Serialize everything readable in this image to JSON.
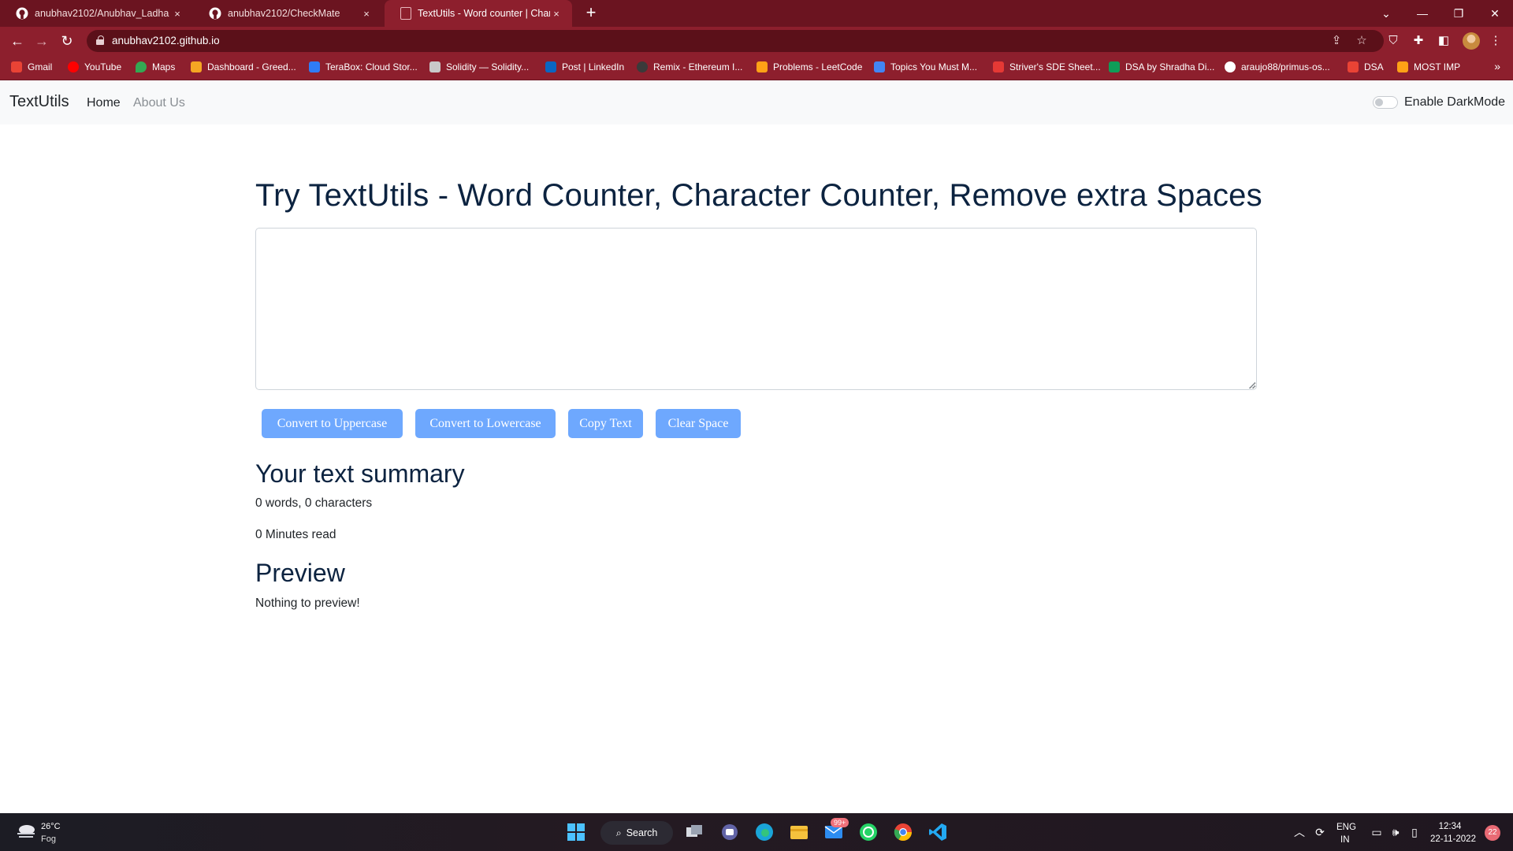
{
  "browser": {
    "tabs": [
      {
        "title": "anubhav2102/Anubhav_Ladha",
        "close": "×"
      },
      {
        "title": "anubhav2102/CheckMate",
        "close": "×"
      },
      {
        "title": "TextUtils - Word counter | Charac",
        "close": "×"
      }
    ],
    "new_tab": "+",
    "url": "anubhav2102.github.io",
    "bookmarks": [
      {
        "label": "Gmail",
        "color": "#ea4335"
      },
      {
        "label": "YouTube",
        "color": "#ff0000"
      },
      {
        "label": "Maps",
        "color": "#34a853"
      },
      {
        "label": "Dashboard - Greed...",
        "color": "#f5a623"
      },
      {
        "label": "TeraBox: Cloud Stor...",
        "color": "#2f7cf6"
      },
      {
        "label": "Solidity — Solidity...",
        "color": "#c9c9c9"
      },
      {
        "label": "Post | LinkedIn",
        "color": "#0a66c2"
      },
      {
        "label": "Remix - Ethereum I...",
        "color": "#3a3a3a"
      },
      {
        "label": "Problems - LeetCode",
        "color": "#ffa116"
      },
      {
        "label": "Topics You Must M...",
        "color": "#4285f4"
      },
      {
        "label": "Striver's SDE Sheet...",
        "color": "#e53935"
      },
      {
        "label": "DSA by Shradha Di...",
        "color": "#0f9d58"
      },
      {
        "label": "araujo88/primus-os...",
        "color": "#ffffff"
      },
      {
        "label": "DSA",
        "color": "#ea4335"
      },
      {
        "label": "MOST IMP",
        "color": "#ffa116"
      }
    ]
  },
  "site": {
    "brand": "TextUtils",
    "nav": {
      "home": "Home",
      "about": "About Us"
    },
    "darkmode_label": "Enable DarkMode",
    "darkmode_on": false,
    "heading": "Try TextUtils - Word Counter, Character Counter, Remove extra Spaces",
    "textarea_value": "",
    "buttons": {
      "uppercase": "Convert to Uppercase",
      "lowercase": "Convert to Lowercase",
      "copy": "Copy Text",
      "clear": "Clear Space"
    },
    "summary_heading": "Your text summary",
    "summary_counts": "0 words, 0 characters",
    "read_time": "0 Minutes read",
    "preview_heading": "Preview",
    "preview_text": "Nothing to preview!",
    "colors": {
      "accent": "#6ea8fe",
      "heading": "#0c2340",
      "tab_strip": "#6b1420",
      "toolbar": "#8d1f2d"
    }
  },
  "taskbar": {
    "weather_temp": "26°C",
    "weather_cond": "Fog",
    "search_label": "Search",
    "mail_badge": "99+",
    "language": "ENG",
    "region": "IN",
    "time": "12:34",
    "date": "22-11-2022",
    "notifications": "22"
  }
}
